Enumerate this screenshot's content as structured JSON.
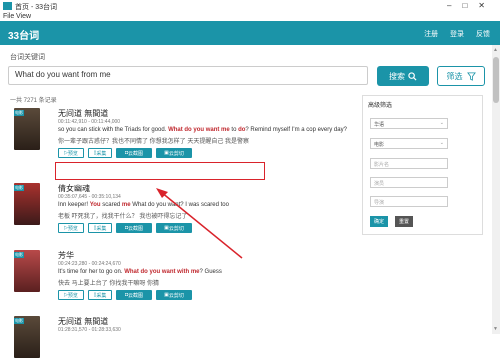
{
  "window": {
    "title": "首页 - 33台词"
  },
  "menu": {
    "file": "File",
    "view": "View"
  },
  "nav": {
    "brand": "33台词",
    "register": "注册",
    "login": "登录",
    "feedback": "反馈"
  },
  "search": {
    "label": "台词关键词",
    "value": "What do you want from me",
    "button": "搜索",
    "filter": "筛选"
  },
  "count": "一共 7271 条记录",
  "results": [
    {
      "title": "无间道 無間道",
      "time": "00:11:42,910 - 00:11:44,000",
      "en_pre": "so you can stick with the Triads for good. ",
      "en_hl": "What do you want me",
      "en_mid": " to ",
      "en_hl2": "do",
      "en_post": "? Remind myself I'm a cop every day?",
      "cn": "你一辈子跟古惑仔？我也不同情了 你想我怎样了 天天提醒自己 我是警察",
      "tag": "电影"
    },
    {
      "title": "倩女幽魂",
      "time": "00:35:07,645 - 00:35:10,134",
      "en_pre": "Inn keeper! ",
      "en_hl": "You",
      "en_mid": " scared ",
      "en_hl2": "me",
      "en_post": " What do you want? I was scared too",
      "cn": "老板 吓死我了，找我干什么？ 我也被吓得忘记了",
      "tag": "电影"
    },
    {
      "title": "芳华",
      "time": "00:24:23,280 - 00:24:24,670",
      "en_pre": "It's time for her to go on. ",
      "en_hl": "What do you want with me",
      "en_mid": "? Guess",
      "en_hl2": "",
      "en_post": "",
      "cn": "快去 马上要上台了 你找我干嘛呀 你猜",
      "tag": "电影"
    },
    {
      "title": "无间道 無間道",
      "time": "01:28:31,570 - 01:28:33,630",
      "en_pre": "",
      "en_hl": "",
      "en_mid": "",
      "en_hl2": "",
      "en_post": "",
      "cn": "",
      "tag": "电影"
    }
  ],
  "actions": {
    "preview": "预览",
    "collect": "采集",
    "screenshot": "云截图",
    "clip": "云剪切"
  },
  "sidebar": {
    "title": "高级筛选",
    "language": "华语",
    "category": "电影",
    "year_placeholder": "影片名",
    "actor_placeholder": "演员",
    "keyword_placeholder": "导演",
    "confirm": "确定",
    "reset": "重置"
  },
  "colors": {
    "accent": "#1b94a8",
    "highlight": "#c0282e",
    "annotation": "#d9232b"
  },
  "icons": [
    "app-icon",
    "search-icon",
    "filter-icon",
    "play-icon",
    "bookmark-icon",
    "camera-icon",
    "film-icon"
  ]
}
